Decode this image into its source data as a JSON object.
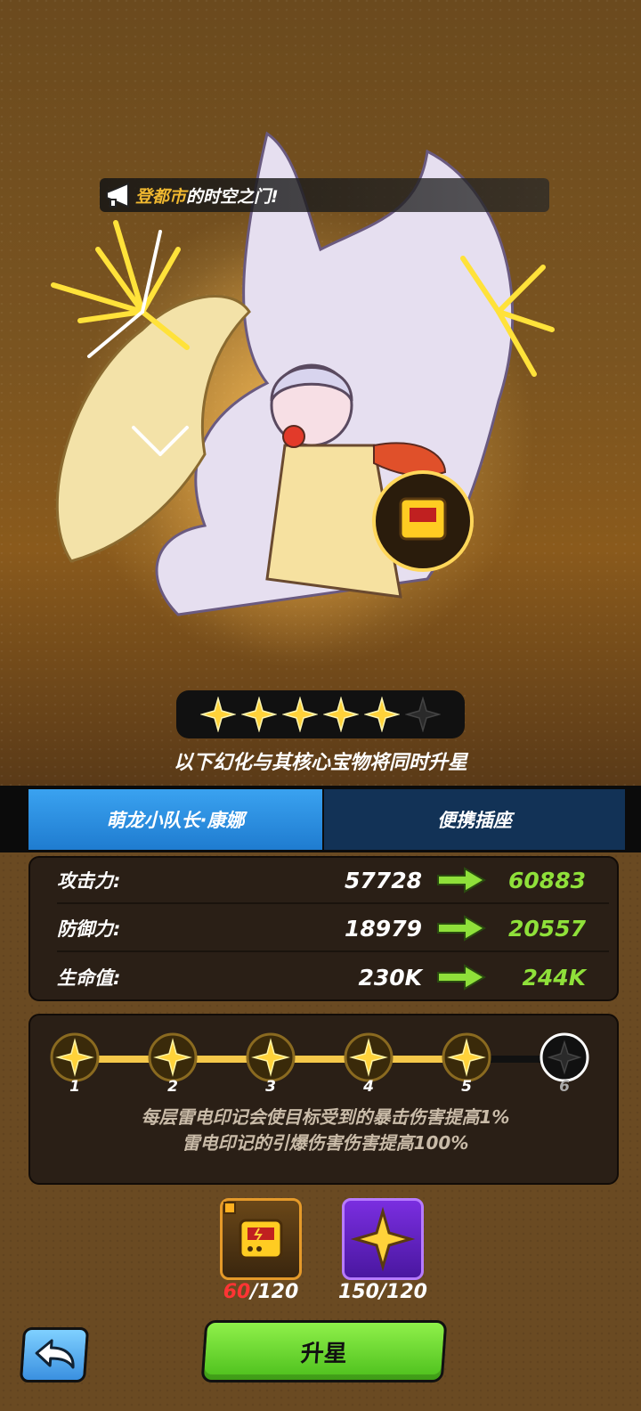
{
  "banner": {
    "highlight": "登都市",
    "text": "的时空之门!",
    "icon": "megaphone-icon"
  },
  "star_rating": {
    "filled": 5,
    "total": 6
  },
  "subtitle": "以下幻化与其核心宝物将同时升星",
  "tabs": [
    {
      "label": "萌龙小队长·康娜",
      "active": true
    },
    {
      "label": "便携插座",
      "active": false
    }
  ],
  "stats": [
    {
      "label": "攻击力:",
      "old": "57728",
      "new": "60883"
    },
    {
      "label": "防御力:",
      "old": "18979",
      "new": "20557"
    },
    {
      "label": "生命值:",
      "old": "230K",
      "new": "244K"
    }
  ],
  "levels": {
    "nodes": [
      "1",
      "2",
      "3",
      "4",
      "5",
      "6"
    ],
    "unlocked": 5,
    "description_line1": "每层雷电印记会使目标受到的暴击伤害提高1%",
    "description_line2": "雷电印记的引爆伤害伤害提高100%"
  },
  "materials": [
    {
      "icon": "portable-socket-icon",
      "have": "60",
      "need": "/120"
    },
    {
      "icon": "gold-star-icon",
      "have": "150",
      "need": "/120"
    }
  ],
  "buttons": {
    "upgrade": "升星",
    "back_icon": "back-arrow-icon"
  },
  "colors": {
    "tab_active": "#2f90e0",
    "tab_inactive": "#123256",
    "new_value": "#8fe03a",
    "star_gold": "#ffd23a",
    "upgrade_button": "#6ad42e",
    "insufficient": "#ff3434"
  }
}
